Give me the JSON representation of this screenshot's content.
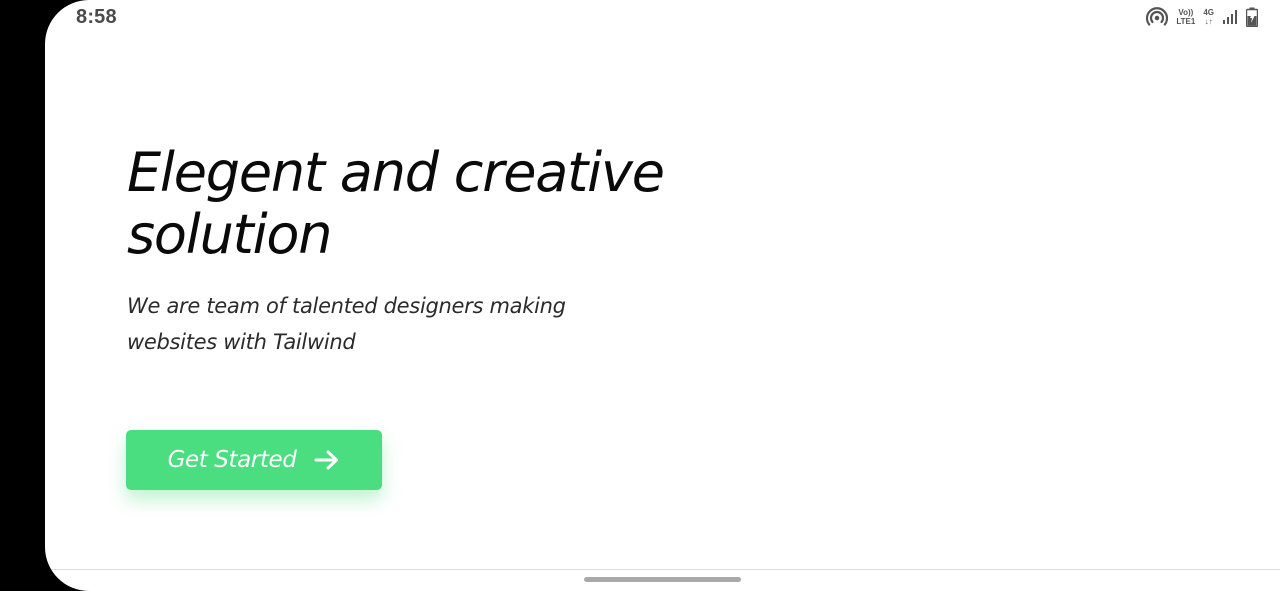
{
  "status_bar": {
    "time": "8:58",
    "volte_label": "Vo))",
    "lte_label": "LTE1",
    "network_label": "4G",
    "icons": [
      "hotspot-icon",
      "volte-icon",
      "network-4g-icon",
      "signal-icon",
      "battery-icon"
    ]
  },
  "hero": {
    "title": "Elegent and creative solution",
    "subtitle": "We are team of talented designers making websites with Tailwind"
  },
  "cta": {
    "label": "Get Started",
    "icon": "arrow-right-icon",
    "color": "#4ade80"
  },
  "colors": {
    "background": "#ffffff",
    "frame": "#000000",
    "text": "#0a0a0a"
  }
}
